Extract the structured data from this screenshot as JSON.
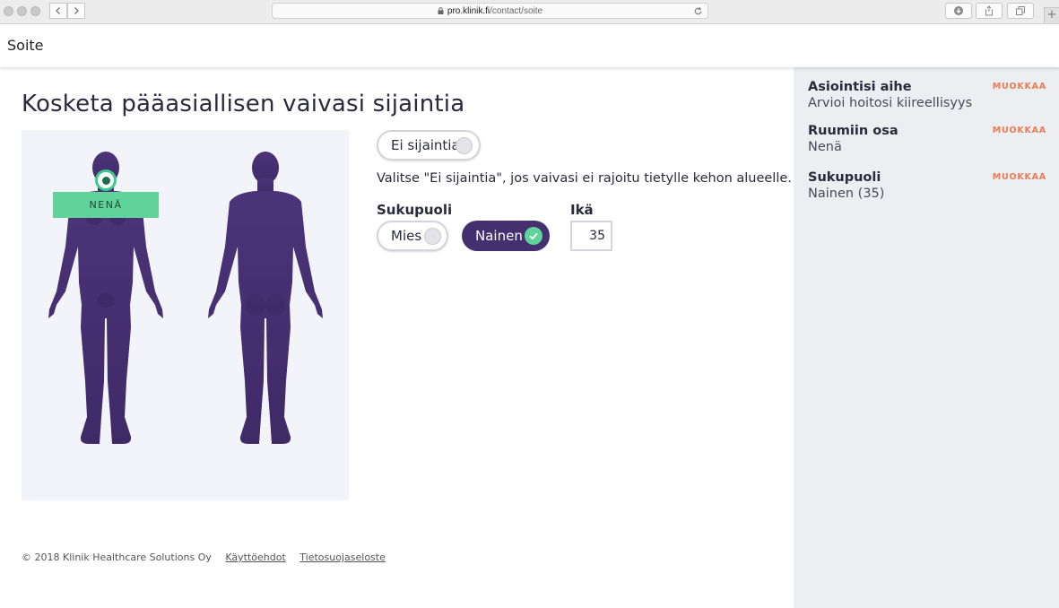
{
  "browser": {
    "url_domain": "pro.klinik.fi",
    "url_path": "/contact/soite"
  },
  "app": {
    "title": "Soite"
  },
  "main": {
    "heading": "Kosketa pääasiallisen vaivasi sijaintia",
    "selected_location_label": "NENÄ",
    "no_location_label": "Ei sijaintia",
    "hint": "Valitse \"Ei sijaintia\", jos vaivasi ei rajoitu tietylle kehon alueelle.",
    "gender_label": "Sukupuoli",
    "gender_options": [
      {
        "label": "Mies",
        "selected": false
      },
      {
        "label": "Nainen",
        "selected": true
      }
    ],
    "age_label": "Ikä",
    "age_value": "35"
  },
  "footer": {
    "copyright": "© 2018 Klinik Healthcare Solutions Oy",
    "links": [
      "Käyttöehdot",
      "Tietosuojaseloste"
    ]
  },
  "sidebar": {
    "items": [
      {
        "title": "Asiointisi aihe",
        "value": "Arvioi hoitosi kiireellisyys",
        "edit": "MUOKKAA"
      },
      {
        "title": "Ruumiin osa",
        "value": "Nenä",
        "edit": "MUOKKAA"
      },
      {
        "title": "Sukupuoli",
        "value": "Nainen (35)",
        "edit": "MUOKKAA"
      }
    ]
  },
  "colors": {
    "body_figure": "#4b3478",
    "accent_green": "#5fd39a",
    "selected_pill": "#45306f",
    "edit_link": "#ee7a55",
    "sidebar_bg": "#eceef1"
  },
  "icons": [
    "back-icon",
    "forward-icon",
    "lock-icon",
    "reload-icon",
    "download-icon",
    "share-icon",
    "tabs-icon",
    "plus-icon",
    "check-icon"
  ]
}
